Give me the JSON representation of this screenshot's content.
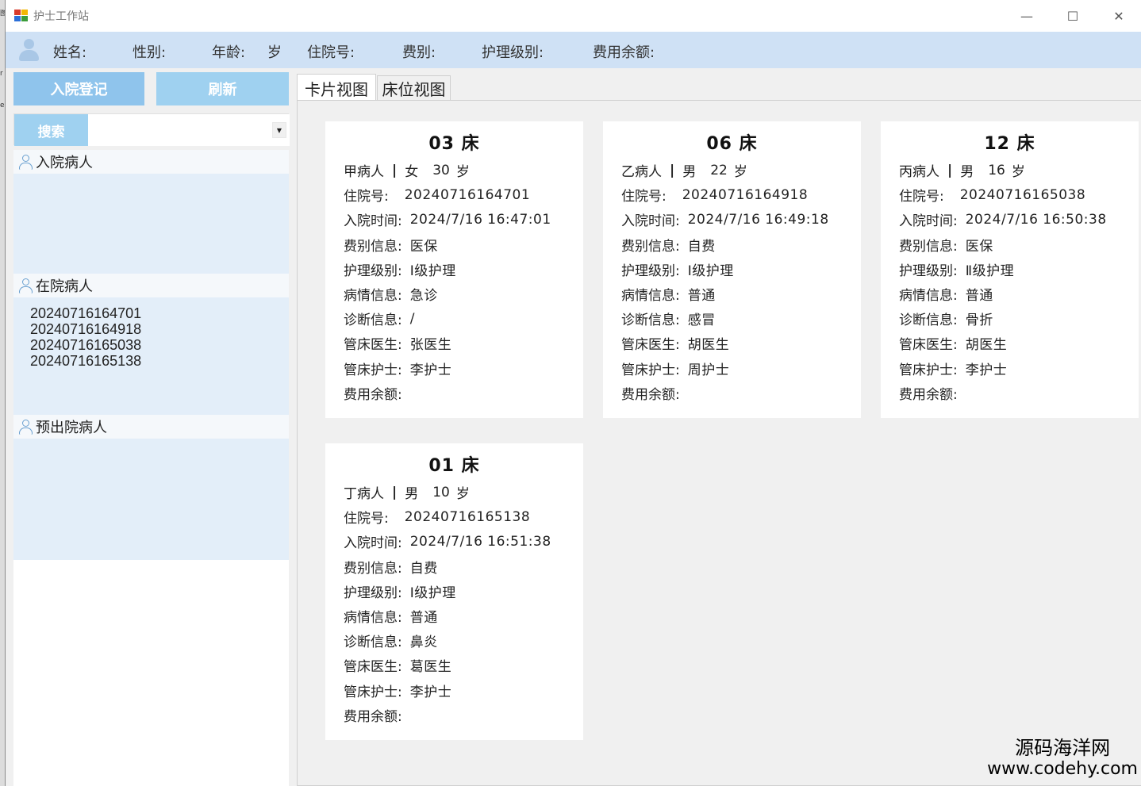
{
  "window": {
    "title": "护士工作站",
    "minimize_glyph": "—",
    "maximize_glyph": "☐",
    "close_glyph": "✕"
  },
  "patient_info": {
    "name_label": "姓名:",
    "gender_label": "性别:",
    "age_label": "年龄:",
    "age_unit": "岁",
    "admission_no_label": "住院号:",
    "fee_type_label": "费别:",
    "care_level_label": "护理级别:",
    "balance_label": "费用余额:"
  },
  "left_panel": {
    "admit_button": "入院登记",
    "refresh_button": "刷新",
    "search_button": "搜索",
    "search_select_value": "",
    "groups": [
      {
        "label": "入院病人",
        "items": []
      },
      {
        "label": "在院病人",
        "items": [
          "20240716164701",
          "20240716164918",
          "20240716165038",
          "20240716165138"
        ]
      },
      {
        "label": "预出院病人",
        "items": []
      }
    ]
  },
  "tabs": [
    {
      "label": "卡片视图",
      "active": true
    },
    {
      "label": "床位视图",
      "active": false
    }
  ],
  "card_labels": {
    "admission_no": "住院号:",
    "admission_time": "入院时间:",
    "fee_info": "费别信息:",
    "care_level": "护理级别:",
    "condition": "病情信息:",
    "diagnosis": "诊断信息:",
    "doctor": "管床医生:",
    "nurse": "管床护士:",
    "balance": "费用余额:",
    "bed_suffix": "床",
    "age_unit": "岁"
  },
  "cards": [
    {
      "bed": "03",
      "name": "甲病人",
      "gender": "女",
      "age": "30",
      "admission_no": "20240716164701",
      "admission_time": "2024/7/16 16:47:01",
      "fee_info": "医保",
      "care_level": "Ⅰ级护理",
      "condition": "急诊",
      "diagnosis": "/",
      "doctor": "张医生",
      "nurse": "李护士",
      "balance": ""
    },
    {
      "bed": "06",
      "name": "乙病人",
      "gender": "男",
      "age": "22",
      "admission_no": "20240716164918",
      "admission_time": "2024/7/16 16:49:18",
      "fee_info": "自费",
      "care_level": "Ⅰ级护理",
      "condition": "普通",
      "diagnosis": "感冒",
      "doctor": "胡医生",
      "nurse": "周护士",
      "balance": ""
    },
    {
      "bed": "12",
      "name": "丙病人",
      "gender": "男",
      "age": "16",
      "admission_no": "20240716165038",
      "admission_time": "2024/7/16 16:50:38",
      "fee_info": "医保",
      "care_level": "Ⅱ级护理",
      "condition": "普通",
      "diagnosis": "骨折",
      "doctor": "胡医生",
      "nurse": "李护士",
      "balance": ""
    },
    {
      "bed": "01",
      "name": "丁病人",
      "gender": "男",
      "age": "10",
      "admission_no": "20240716165138",
      "admission_time": "2024/7/16 16:51:38",
      "fee_info": "自费",
      "care_level": "Ⅰ级护理",
      "condition": "普通",
      "diagnosis": "鼻炎",
      "doctor": "葛医生",
      "nurse": "李护士",
      "balance": ""
    }
  ],
  "watermark": {
    "line1": "源码海洋网",
    "line2": "www.codehy.com"
  },
  "left_strip_fragments": [
    "图",
    "r",
    "er"
  ],
  "colors": {
    "accent_button": "#8fc4ec",
    "light_button": "#9fd1f0",
    "info_bar": "#cfe1f5",
    "list_bg": "#e3eef9"
  }
}
